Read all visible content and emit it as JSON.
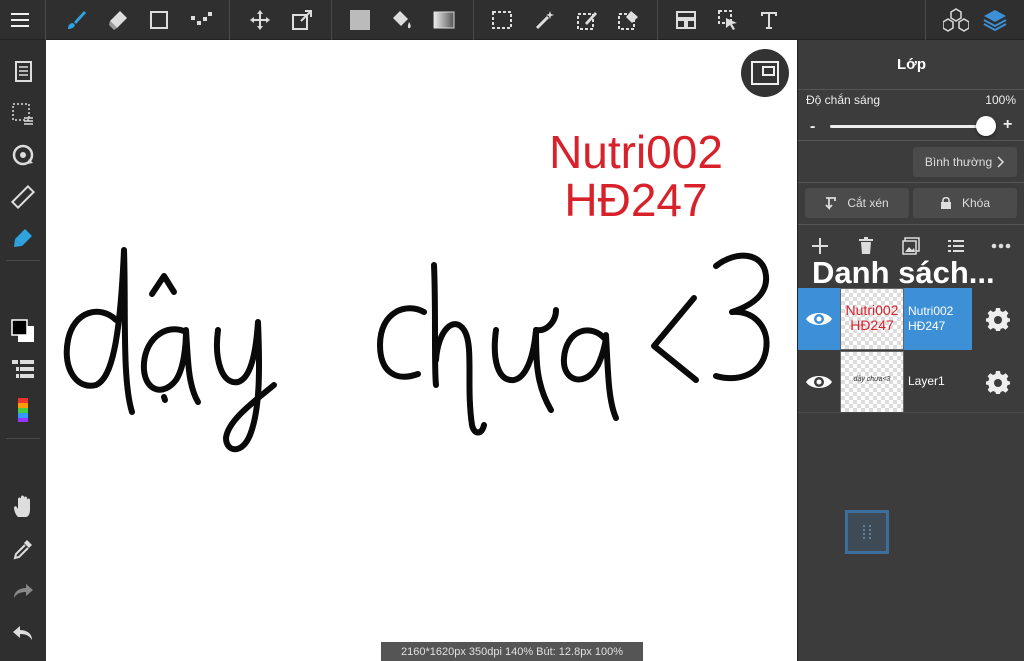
{
  "canvas": {
    "red_text_line1": "Nutri002",
    "red_text_line2": "HĐ247",
    "handwriting": "dậy chưa <3",
    "status": "2160*1620px 350dpi 140% Bút: 12.8px 100%"
  },
  "panel": {
    "title": "Lớp",
    "opacity_label": "Độ chắn sáng",
    "opacity_value": "100%",
    "opacity_level": 1.0,
    "minus": "-",
    "plus": "+",
    "blend_mode": "Bình thường",
    "clip_label": "Cắt xén",
    "lock_label": "Khóa",
    "list_title": "Danh sách...",
    "layers": [
      {
        "name_line1": "Nutri002",
        "name_line2": "HĐ247",
        "thumb_line1": "Nutri002",
        "thumb_line2": "HĐ247"
      },
      {
        "name_line1": "Layer1",
        "thumb_text": "dậy chưa<3"
      }
    ]
  },
  "colors": {
    "accent": "#3d8fd6",
    "red": "#d8222b",
    "pen_blue": "#2fa3e0"
  }
}
